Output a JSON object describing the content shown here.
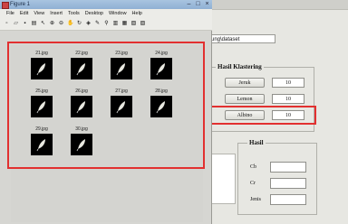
{
  "figure_window": {
    "title": "Figure 1",
    "menu": [
      "File",
      "Edit",
      "View",
      "Insert",
      "Tools",
      "Desktop",
      "Window",
      "Help"
    ],
    "toolbar_icons": [
      "new-icon",
      "open-icon",
      "save-icon",
      "print-icon",
      "pointer-icon",
      "zoom-in-icon",
      "zoom-out-icon",
      "pan-icon",
      "rotate-icon",
      "data-cursor-icon",
      "brush-icon",
      "link-icon",
      "colorbar-icon",
      "legend-icon",
      "hide-tools-icon",
      "show-tools-icon"
    ],
    "images": [
      "21.jpg",
      "22.jpg",
      "23.jpg",
      "24.jpg",
      "25.jpg",
      "26.jpg",
      "27.jpg",
      "28.jpg",
      "29.jpg",
      "30.jpg"
    ]
  },
  "main_app": {
    "path_text": "rung\\dataset",
    "klastering": {
      "title": "Hasil Klastering",
      "items": [
        {
          "label": "Jeruk",
          "value": "10"
        },
        {
          "label": "Lemon",
          "value": "10"
        },
        {
          "label": "Albino",
          "value": "10"
        }
      ]
    },
    "hasil": {
      "title": "Hasil",
      "labels": [
        "Cb",
        "Cr",
        "Jenis"
      ]
    }
  },
  "colors": {
    "highlight": "#e23030",
    "image_bg": "#000000"
  }
}
